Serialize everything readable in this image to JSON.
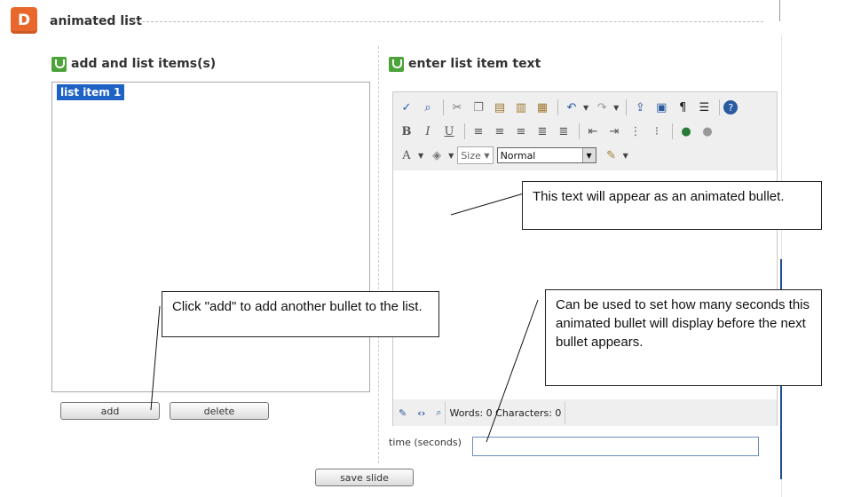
{
  "header": {
    "badge": "D",
    "title": "animated list"
  },
  "left_panel": {
    "title": "add and list items(s)",
    "items": [
      {
        "label": "list item 1",
        "selected": true
      }
    ],
    "add_label": "add",
    "delete_label": "delete"
  },
  "right_panel": {
    "title": "enter list item text",
    "toolbar": {
      "size_label": "Size",
      "format_value": "Normal",
      "icons_row1": [
        "spellcheck-icon",
        "find-icon",
        "cut-icon",
        "copy-icon",
        "paste-icon",
        "paste-text-icon",
        "paste-word-icon",
        "undo-icon",
        "redo-icon",
        "upload-icon",
        "image-icon",
        "paragraph-icon",
        "list-format-icon",
        "help-icon"
      ],
      "icons_row2": [
        "bold-icon",
        "italic-icon",
        "underline-icon",
        "align-left-icon",
        "align-center-icon",
        "align-right-icon",
        "align-justify-icon",
        "align-full-icon",
        "outdent-icon",
        "indent-icon",
        "ordered-list-icon",
        "unordered-list-icon",
        "link-icon",
        "unlink-icon"
      ],
      "icons_row3": [
        "font-color-icon",
        "highlight-color-icon",
        "eraser-icon"
      ]
    },
    "footer": {
      "word_count": "Words: 0 Characters: 0"
    }
  },
  "time": {
    "label": "time (seconds)",
    "value": ""
  },
  "save_label": "save slide",
  "callouts": {
    "editor": "This text will appear as an animated bullet.",
    "add": "Click \"add\" to add another bullet to the list.",
    "time": "Can be used to set how many seconds this animated bullet will display before the next bullet appears."
  },
  "colors": {
    "badge": "#e8672a",
    "section_icon": "#4ca33a",
    "selection": "#1d62c4"
  }
}
